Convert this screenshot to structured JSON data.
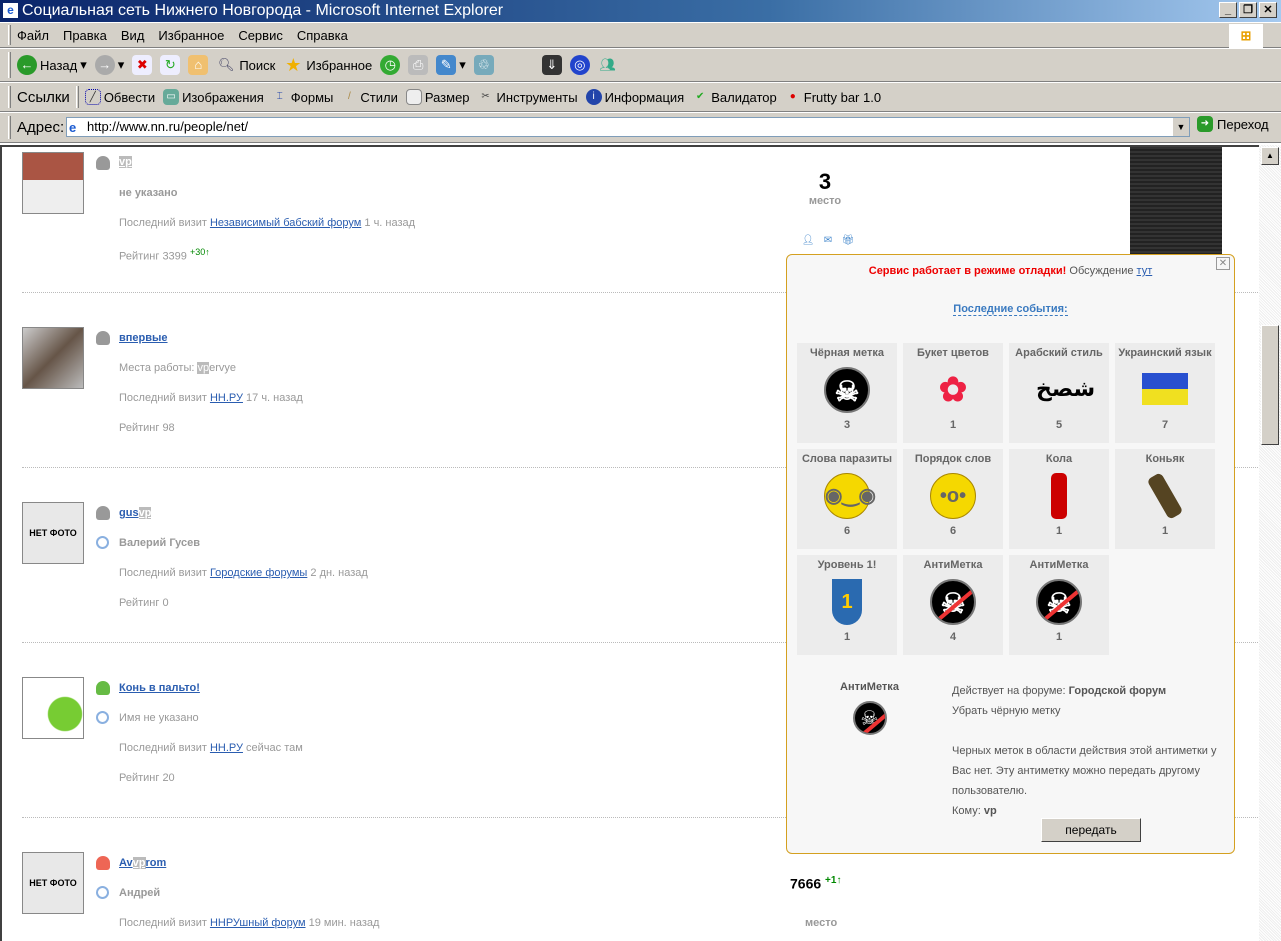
{
  "window": {
    "title": "Социальная сеть Нижнего Новгорода - Microsoft Internet Explorer"
  },
  "menu": [
    "Файл",
    "Правка",
    "Вид",
    "Избранное",
    "Сервис",
    "Справка"
  ],
  "toolbar": {
    "back": "Назад",
    "search": "Поиск",
    "favorites": "Избранное"
  },
  "links": {
    "label": "Ссылки",
    "items": [
      "Обвести",
      "Изображения",
      "Формы",
      "Стили",
      "Размер",
      "Инструменты",
      "Информация",
      "Валидатор",
      "Frutty bar 1.0"
    ]
  },
  "address": {
    "label": "Адрес:",
    "url": "http://www.nn.ru/people/net/",
    "go": "Переход"
  },
  "users": [
    {
      "nick_pre": "",
      "nick_hl": "vp",
      "nick_post": "",
      "name": "не указано",
      "visit_label": "Последний визит",
      "forum": "Независимый бабский форум",
      "ago": "1 ч. назад",
      "rating": "Рейтинг 3399",
      "delta": "+30↑"
    },
    {
      "nick_pre": "впервые",
      "nick_hl": "",
      "nick_post": "",
      "work_label": "Места работы:",
      "work_hl": "vp",
      "work_post": "ervye",
      "visit_label": "Последний визит",
      "forum": "НН.РУ",
      "ago": "17 ч. назад",
      "rating": "Рейтинг 98"
    },
    {
      "nick_pre": "gus",
      "nick_hl": "vp",
      "nick_post": "",
      "photo": "НЕТ ФОТО",
      "name": "Валерий Гусев",
      "visit_label": "Последний визит",
      "forum": "Городские форумы",
      "ago": "2 дн. назад",
      "rating": "Рейтинг 0"
    },
    {
      "nick_pre": "Конь в пальто!",
      "nick_hl": "",
      "nick_post": "",
      "name": "Имя не указано",
      "visit_label": "Последний визит",
      "forum": "НН.РУ",
      "ago": "сейчас там",
      "rating": "Рейтинг 20"
    },
    {
      "nick_pre": "Av",
      "nick_hl": "vp",
      "nick_post": "rom",
      "photo": "НЕТ ФОТО",
      "name": "Андрей",
      "visit_label": "Последний визит",
      "forum": "ННРУшный форум",
      "ago": "19 мин. назад"
    }
  ],
  "rank_top": {
    "value": "3",
    "label": "место"
  },
  "rank_bottom": {
    "value": "7666",
    "delta": "+1↑",
    "label": "место"
  },
  "popup": {
    "warning": "Сервис работает в режиме отладки!",
    "discussion": "Обсуждение",
    "link": "тут",
    "events_title": "Последние события:",
    "items": [
      {
        "title": "Чёрная метка",
        "count": "3"
      },
      {
        "title": "Букет цветов",
        "count": "1"
      },
      {
        "title": "Арабский стиль",
        "count": "5"
      },
      {
        "title": "Украинский язык",
        "count": "7"
      },
      {
        "title": "Слова паразиты",
        "count": "6"
      },
      {
        "title": "Порядок слов",
        "count": "6"
      },
      {
        "title": "Кола",
        "count": "1"
      },
      {
        "title": "Коньяк",
        "count": "1"
      },
      {
        "title": "Уровень 1!",
        "count": "1"
      },
      {
        "title": "АнтиМетка",
        "count": "4"
      },
      {
        "title": "АнтиМетка",
        "count": "1"
      }
    ],
    "detail": {
      "title": "АнтиМетка",
      "forum_label": "Действует на форуме:",
      "forum": "Городской форум",
      "action": "Убрать чёрную метку",
      "info": "Черных меток в области действия этой антиметки у Вас нет. Эту антиметку можно передать другому пользователю.",
      "to_label": "Кому:",
      "to": "vp",
      "button": "передать"
    }
  }
}
